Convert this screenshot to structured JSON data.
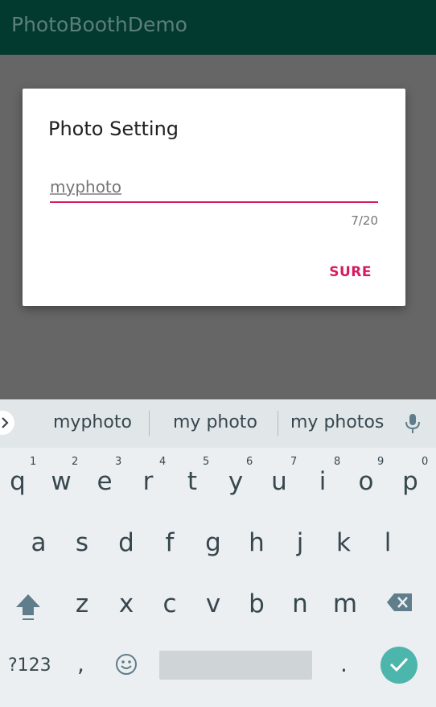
{
  "app_bar": {
    "title": "PhotoBoothDemo"
  },
  "dialog": {
    "title": "Photo Setting",
    "input_value": "myphoto",
    "counter": "7/20",
    "confirm_label": "SURE"
  },
  "keyboard": {
    "suggestions": [
      "myphoto",
      "my photo",
      "my photos"
    ],
    "row1": [
      "q",
      "w",
      "e",
      "r",
      "t",
      "y",
      "u",
      "i",
      "o",
      "p"
    ],
    "row1_hints": [
      "1",
      "2",
      "3",
      "4",
      "5",
      "6",
      "7",
      "8",
      "9",
      "0"
    ],
    "row2": [
      "a",
      "s",
      "d",
      "f",
      "g",
      "h",
      "j",
      "k",
      "l"
    ],
    "row3": [
      "z",
      "x",
      "c",
      "v",
      "b",
      "n",
      "m"
    ],
    "symbols_label": "?123",
    "comma_label": ",",
    "period_label": "."
  },
  "colors": {
    "app_bar": "#023a2f",
    "accent": "#d81b60",
    "enter": "#4db6ac",
    "keyboard_bg": "#eceff1"
  },
  "icons": [
    "chevron-right-icon",
    "microphone-icon",
    "shift-icon",
    "backspace-icon",
    "emoji-icon",
    "checkmark-icon"
  ]
}
